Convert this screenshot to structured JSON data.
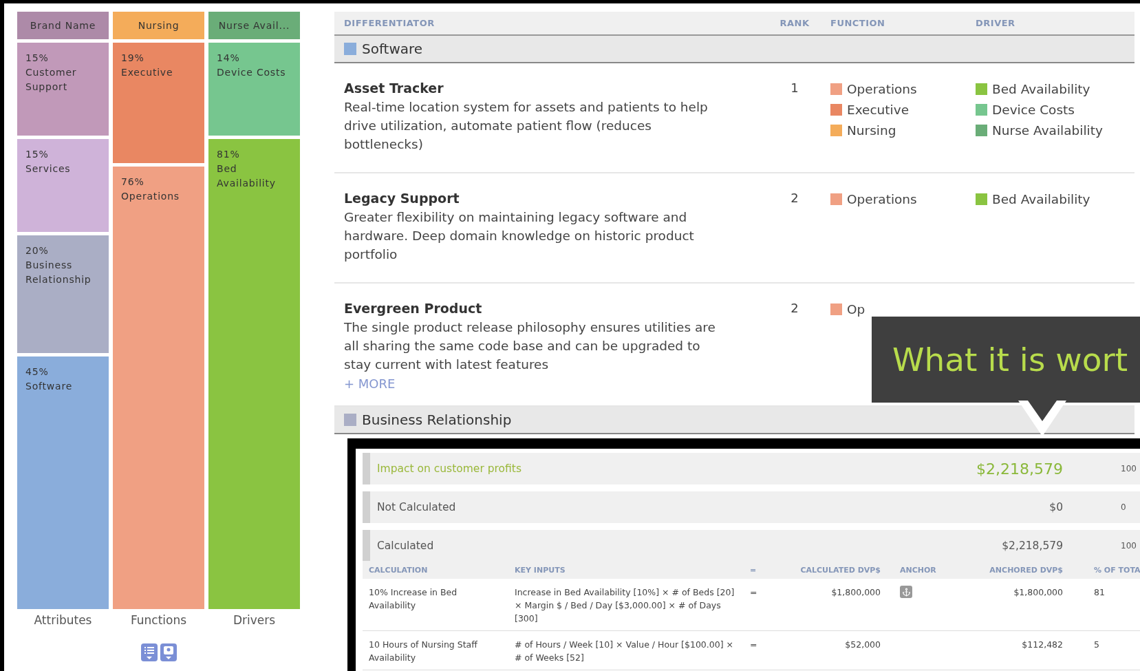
{
  "treemap": {
    "columns": [
      {
        "label": "Attributes",
        "blocks": [
          {
            "kind": "header",
            "text": "Brand Name",
            "color": "#ad8aa8"
          },
          {
            "kind": "block",
            "percent": "15%",
            "text": "Customer Support",
            "color": "#c199b9"
          },
          {
            "kind": "block",
            "percent": "15%",
            "text": "Services",
            "color": "#cfb3d9"
          },
          {
            "kind": "block",
            "percent": "20%",
            "text": "Business Relationship",
            "color": "#aaaec5"
          },
          {
            "kind": "block",
            "percent": "45%",
            "text": "Software",
            "color": "#8aaddb"
          }
        ]
      },
      {
        "label": "Functions",
        "blocks": [
          {
            "kind": "header",
            "text": "Nursing",
            "color": "#f4ac5a"
          },
          {
            "kind": "block",
            "percent": "19%",
            "text": "Executive",
            "color": "#e98762"
          },
          {
            "kind": "block",
            "percent": "76%",
            "text": "Operations",
            "color": "#f0a083"
          }
        ]
      },
      {
        "label": "Drivers",
        "blocks": [
          {
            "kind": "header",
            "text": "Nurse Avail...",
            "color": "#6aad78"
          },
          {
            "kind": "block",
            "percent": "14%",
            "text": "Device Costs",
            "color": "#76c68f"
          },
          {
            "kind": "block",
            "percent": "81%",
            "text": "Bed Availability",
            "color": "#8ac441"
          }
        ]
      }
    ]
  },
  "table": {
    "columns": [
      "DIFFERENTIATOR",
      "RANK",
      "FUNCTION",
      "DRIVER"
    ],
    "groups": [
      {
        "name": "Software",
        "color": "#8aaddb",
        "rows": [
          {
            "title": "Asset Tracker",
            "description": "Real-time location system for assets and patients to help drive utilization, automate patient flow (reduces bottlenecks)",
            "rank": "1",
            "functions": [
              {
                "label": "Operations",
                "color": "#f0a083"
              },
              {
                "label": "Executive",
                "color": "#e98762"
              },
              {
                "label": "Nursing",
                "color": "#f4ac5a"
              }
            ],
            "drivers": [
              {
                "label": "Bed Availability",
                "color": "#8ac441"
              },
              {
                "label": "Device Costs",
                "color": "#76c68f"
              },
              {
                "label": "Nurse Availability",
                "color": "#6aad78"
              }
            ]
          },
          {
            "title": "Legacy Support",
            "description": "Greater flexibility on maintaining legacy software and hardware. Deep domain knowledge on historic product portfolio",
            "rank": "2",
            "functions": [
              {
                "label": "Operations",
                "color": "#f0a083"
              }
            ],
            "drivers": [
              {
                "label": "Bed Availability",
                "color": "#8ac441"
              }
            ]
          },
          {
            "title": "Evergreen Product",
            "description": "The single product release philosophy ensures utilities are all sharing the same code base and can be upgraded to stay current with latest features",
            "more": "+ MORE",
            "rank": "2",
            "functions": [
              {
                "label": "Op",
                "color": "#f0a083"
              }
            ]
          }
        ]
      },
      {
        "name": "Business Relationship",
        "color": "#aaaec5"
      }
    ]
  },
  "callout": {
    "text": "What it is wort"
  },
  "popup": {
    "summary": [
      {
        "kind": "impact",
        "label": "Impact on customer profits",
        "value": "$2,218,579",
        "percent": "100"
      },
      {
        "kind": "plain",
        "label": "Not Calculated",
        "value": "$0",
        "percent": "0"
      },
      {
        "kind": "plain",
        "label": "Calculated",
        "value": "$2,218,579",
        "percent": "100"
      }
    ],
    "columns": [
      "CALCULATION",
      "KEY INPUTS",
      "=",
      "CALCULATED DVP$",
      "ANCHOR",
      "ANCHORED DVP$",
      "% OF TOTA"
    ],
    "rows": [
      {
        "calculation": "10% Increase in Bed Availability",
        "key_inputs": "Increase in Bed Availability [10%] × # of Beds [20] × Margin $ / Bed / Day [$3,000.00] × # of Days [300]",
        "equals": "=",
        "calculated": "$1,800,000",
        "anchor": true,
        "anchored": "$1,800,000",
        "percent": "81"
      },
      {
        "calculation": "10 Hours of Nursing Staff Availability",
        "key_inputs": "# of Hours / Week [10] × Value / Hour [$100.00] × # of Weeks [52]",
        "equals": "=",
        "calculated": "$52,000",
        "anchor": false,
        "anchored": "$112,482",
        "percent": "5"
      }
    ]
  }
}
